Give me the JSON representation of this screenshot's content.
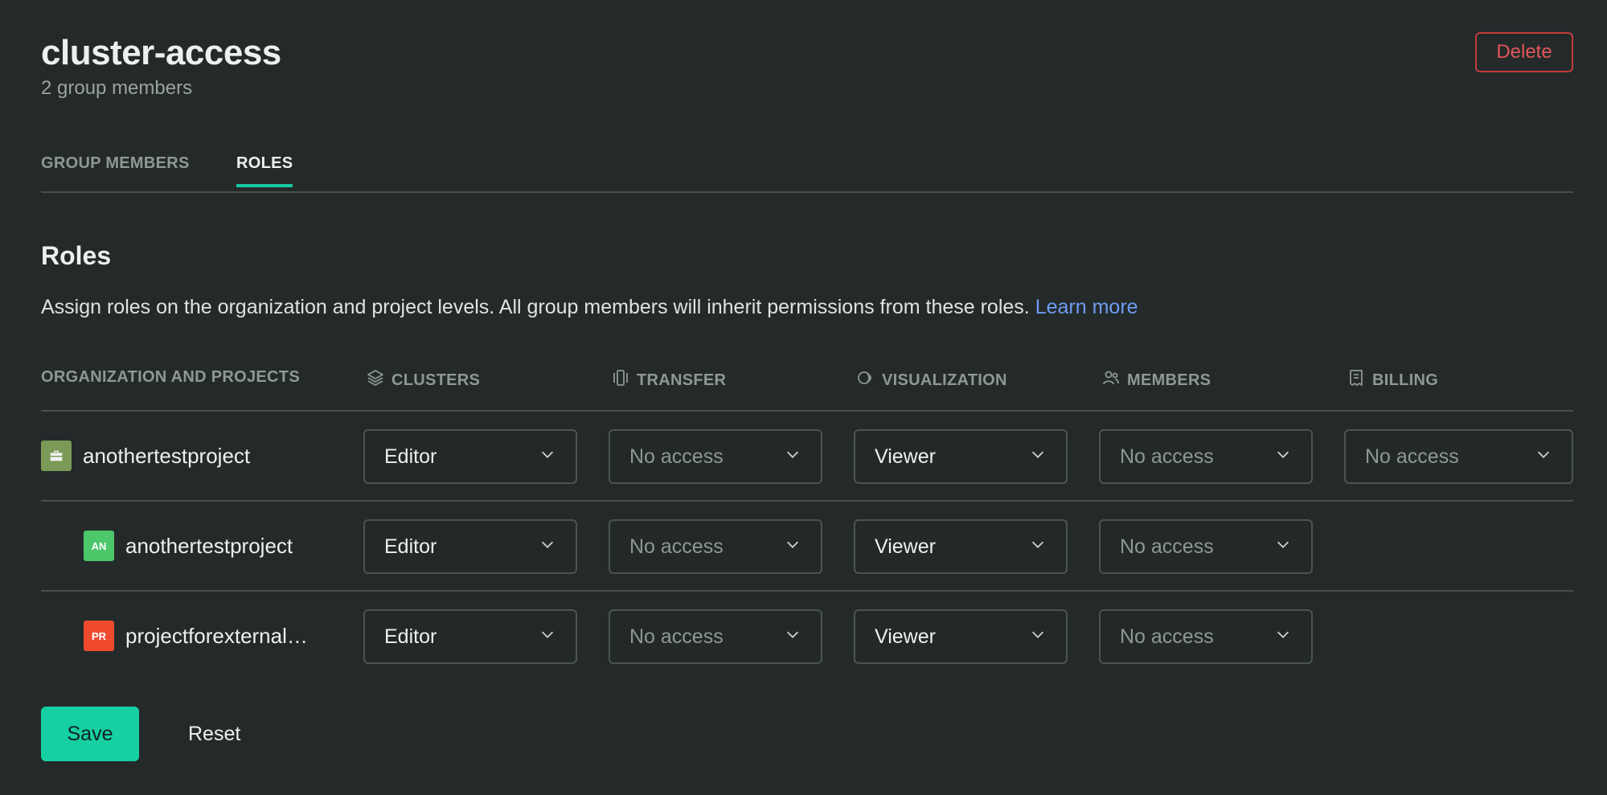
{
  "header": {
    "title": "cluster-access",
    "subtitle": "2 group members",
    "delete_label": "Delete"
  },
  "tabs": [
    {
      "label": "GROUP MEMBERS",
      "active": false
    },
    {
      "label": "ROLES",
      "active": true
    }
  ],
  "section": {
    "title": "Roles",
    "description": "Assign roles on the organization and project levels. All group members will inherit permissions from these roles.",
    "learn_more": "Learn more"
  },
  "table": {
    "columns": [
      {
        "label": "ORGANIZATION AND PROJECTS",
        "icon": ""
      },
      {
        "label": "CLUSTERS",
        "icon": "layers-icon"
      },
      {
        "label": "TRANSFER",
        "icon": "transfer-icon"
      },
      {
        "label": "VISUALIZATION",
        "icon": "visualization-icon"
      },
      {
        "label": "MEMBERS",
        "icon": "members-icon"
      },
      {
        "label": "BILLING",
        "icon": "receipt-icon"
      }
    ],
    "rows": [
      {
        "name": "anothertestproject",
        "badge": "",
        "badge_icon": "briefcase-icon",
        "badge_color": "#7a9a55",
        "clusters": "Editor",
        "transfer": "No access",
        "visualization": "Viewer",
        "members": "No access",
        "billing": "No access"
      },
      {
        "name": "anothertestproject",
        "badge": "AN",
        "badge_color": "#4cc76a",
        "clusters": "Editor",
        "transfer": "No access",
        "visualization": "Viewer",
        "members": "No access"
      },
      {
        "name": "projectforexternal…",
        "badge": "PR",
        "badge_color": "#ef4a2e",
        "clusters": "Editor",
        "transfer": "No access",
        "visualization": "Viewer",
        "members": "No access"
      }
    ]
  },
  "actions": {
    "save_label": "Save",
    "reset_label": "Reset"
  },
  "colors": {
    "accent": "#17c9a2",
    "danger": "#e0565a",
    "link": "#6f9cf2",
    "background": "#242a2a"
  }
}
